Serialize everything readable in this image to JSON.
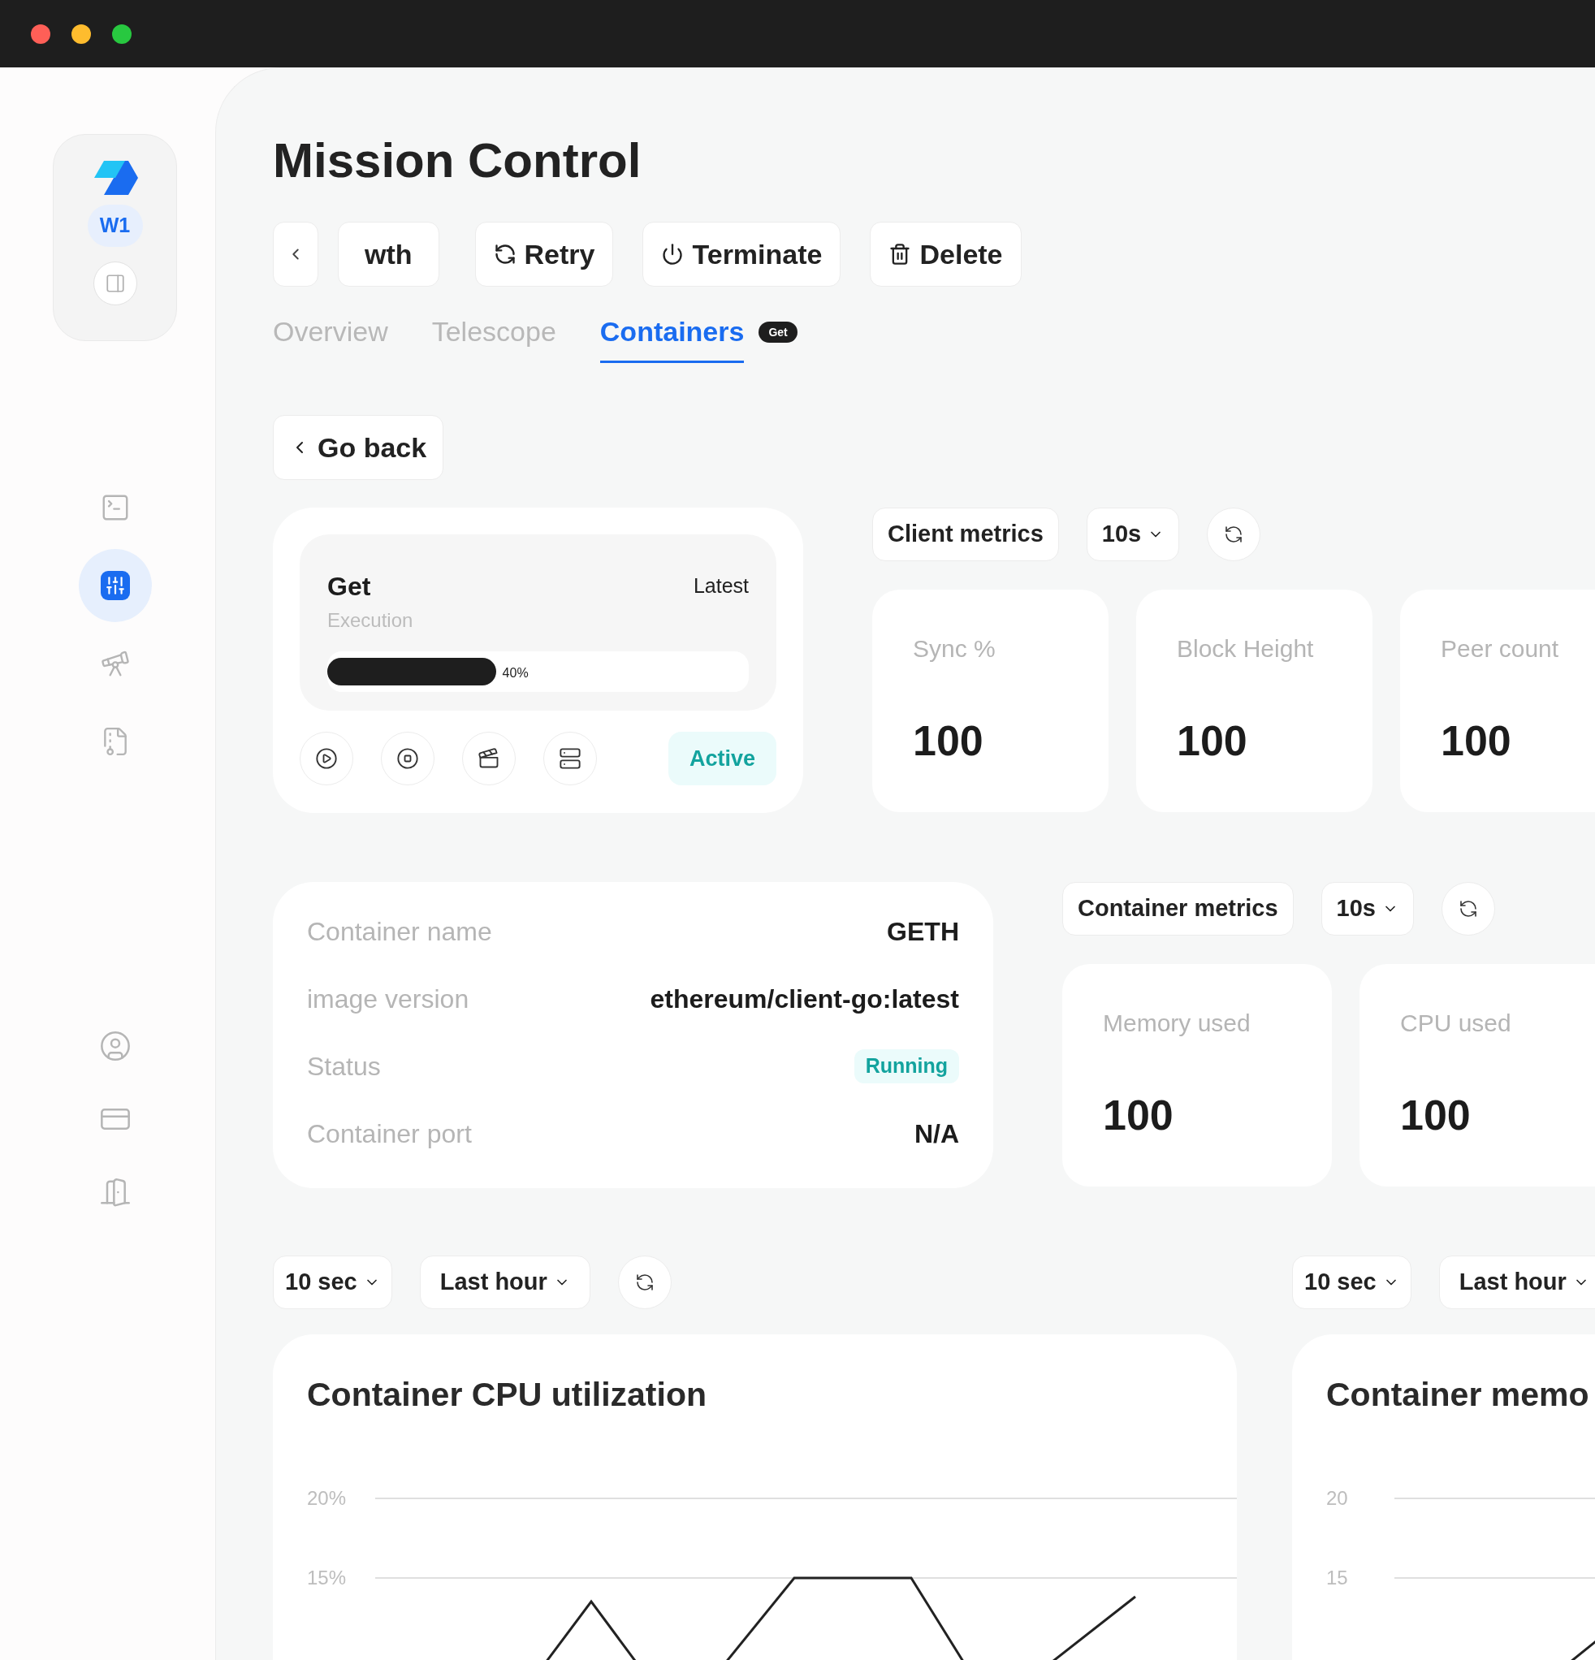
{
  "sidebar": {
    "workspace": "W1",
    "nav_items": [
      {
        "selected": false
      },
      {
        "selected": true
      },
      {
        "selected": false
      },
      {
        "selected": false
      }
    ]
  },
  "page_title": "Mission Control",
  "toolbar": {
    "name_chip": "wth",
    "actions": [
      {
        "label": "Retry",
        "kind": "retry"
      },
      {
        "label": "Terminate",
        "kind": "terminate"
      },
      {
        "label": "Delete",
        "kind": "delete"
      }
    ]
  },
  "tabs": [
    {
      "label": "Overview",
      "selected": false
    },
    {
      "label": "Telescope",
      "selected": false
    },
    {
      "label": "Containers",
      "selected": true,
      "badge": "Get"
    }
  ],
  "go_back": "Go back",
  "client_card": {
    "name": "Get",
    "version": "Latest",
    "layer": "Execution",
    "progress": {
      "level": 0.4,
      "reading": "40%"
    },
    "status": "Active"
  },
  "client_metrics": {
    "title": "Client metrics",
    "interval": "10s",
    "cards": [
      {
        "label": "Sync %",
        "value": "100"
      },
      {
        "label": "Block Height",
        "value": "100"
      },
      {
        "label": "Peer count",
        "value": "100"
      }
    ]
  },
  "container_info": {
    "rows": [
      {
        "label": "Container name",
        "value": "GETH",
        "kind": "text"
      },
      {
        "label": "image version",
        "value": "ethereum/client-go:latest",
        "kind": "text"
      },
      {
        "label": "Status",
        "value": "Running",
        "kind": "badge"
      },
      {
        "label": "Container port",
        "value": "N/A",
        "kind": "text"
      }
    ]
  },
  "container_metrics": {
    "title": "Container metrics",
    "interval": "10s",
    "cards": [
      {
        "label": "Memory used",
        "value": "100"
      },
      {
        "label": "CPU used",
        "value": "100"
      }
    ]
  },
  "charts": [
    {
      "interval": "10 sec",
      "range": "Last hour",
      "refresh_button": true,
      "title": "Container CPU utilization",
      "y_axis_labels": [
        "20%",
        "15%"
      ],
      "kind": "cpu"
    },
    {
      "interval": "10 sec",
      "range": "Last hour",
      "title": "Container memo",
      "y_axis_labels": [
        "20",
        "15"
      ],
      "kind": "memory"
    }
  ]
}
